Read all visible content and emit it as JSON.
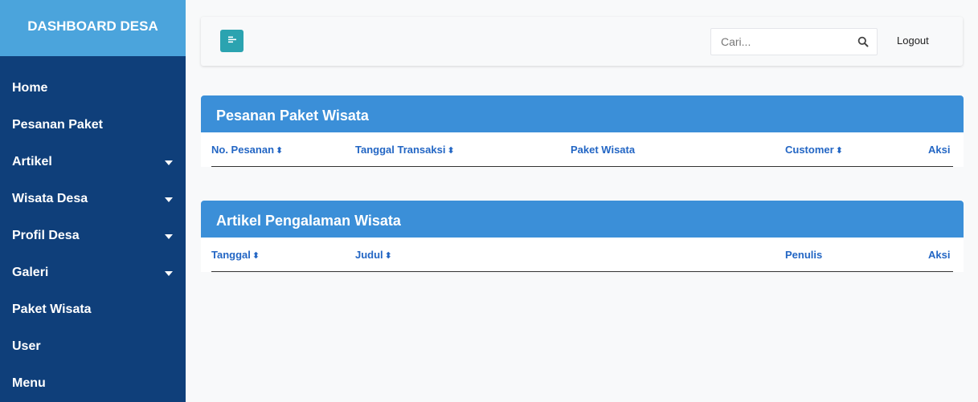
{
  "sidebar": {
    "brand": "DASHBOARD DESA",
    "items": [
      {
        "label": "Home",
        "caret": false
      },
      {
        "label": "Pesanan Paket",
        "caret": false
      },
      {
        "label": "Artikel",
        "caret": true
      },
      {
        "label": "Wisata Desa",
        "caret": true
      },
      {
        "label": "Profil Desa",
        "caret": true
      },
      {
        "label": "Galeri",
        "caret": true
      },
      {
        "label": "Paket Wisata",
        "caret": false
      },
      {
        "label": "User",
        "caret": false
      },
      {
        "label": "Menu",
        "caret": false
      }
    ]
  },
  "topbar": {
    "toggle_icon": "menu-toggle-icon",
    "search_placeholder": "Cari...",
    "search_icon": "search-icon",
    "logout_label": "Logout"
  },
  "panels": {
    "orders": {
      "title": "Pesanan Paket Wisata",
      "columns": [
        {
          "label": "No. Pesanan",
          "sort": "⇕"
        },
        {
          "label": "Tanggal Transaksi",
          "sort": "⇕"
        },
        {
          "label": "Paket Wisata",
          "sort": ""
        },
        {
          "label": "Customer",
          "sort": "⇕"
        },
        {
          "label": "Aksi",
          "sort": ""
        }
      ]
    },
    "articles": {
      "title": "Artikel Pengalaman Wisata",
      "columns": [
        {
          "label": "Tanggal",
          "sort": "⇕"
        },
        {
          "label": "Judul",
          "sort": "⇕"
        },
        {
          "label": "Penulis",
          "sort": ""
        },
        {
          "label": "Aksi",
          "sort": ""
        }
      ]
    }
  },
  "colors": {
    "sidebar_bg": "#0f3f7a",
    "brand_bg": "#4ba4dc",
    "panel_header": "#3b8fd8",
    "toggle_btn": "#2ba3b0",
    "column_text": "#2366c4"
  }
}
